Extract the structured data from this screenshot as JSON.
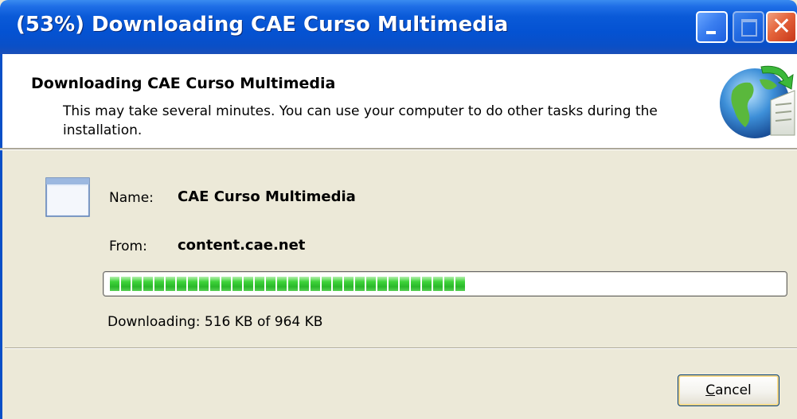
{
  "window": {
    "title": "(53%) Downloading CAE Curso Multimedia",
    "controls": {
      "minimize": "minimize-icon",
      "maximize": "maximize-icon",
      "close": "close-icon"
    }
  },
  "header": {
    "title": "Downloading CAE Curso Multimedia",
    "description": "This may take several minutes. You can use your computer to do other tasks during the installation.",
    "icon": "globe-install-icon"
  },
  "details": {
    "name_label": "Name:",
    "name_value": "CAE Curso Multimedia",
    "from_label": "From:",
    "from_value": "content.cae.net",
    "app_icon": "application-window-icon"
  },
  "progress": {
    "percent": 53,
    "downloaded": "516 KB",
    "total": "964 KB",
    "status_text": "Downloading: 516 KB of 964 KB",
    "fill_color": "#2ab82a"
  },
  "buttons": {
    "cancel_prefix": "",
    "cancel_mnemonic": "C",
    "cancel_rest": "ancel"
  },
  "colors": {
    "titlebar": "#0452d2",
    "dialog_bg": "#ECE9D8",
    "header_bg": "#FFFFFF"
  }
}
